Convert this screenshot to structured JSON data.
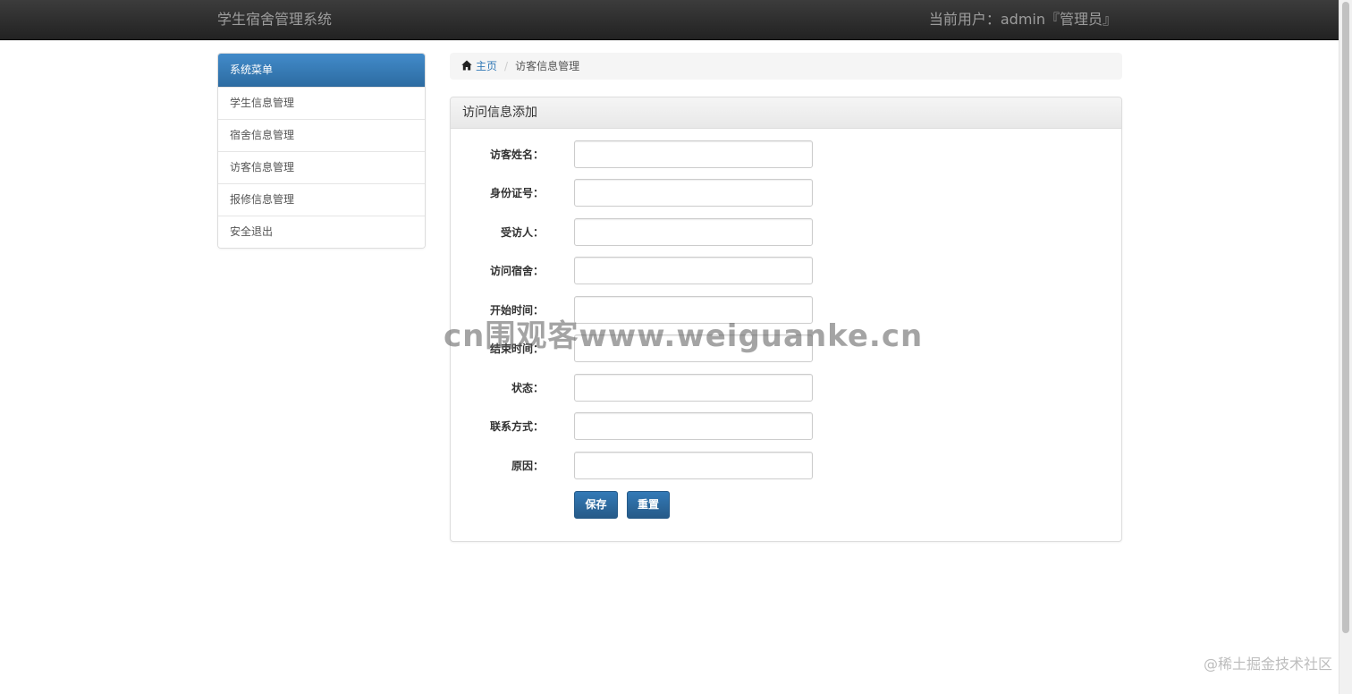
{
  "navbar": {
    "brand": "学生宿舍管理系统",
    "current_user": "当前用户：admin『管理员』"
  },
  "sidebar": {
    "heading": "系统菜单",
    "items": [
      {
        "label": "学生信息管理"
      },
      {
        "label": "宿舍信息管理"
      },
      {
        "label": "访客信息管理"
      },
      {
        "label": "报修信息管理"
      },
      {
        "label": "安全退出"
      }
    ]
  },
  "breadcrumb": {
    "home_icon": "home-icon",
    "home": "主页",
    "separator": "/",
    "current": "访客信息管理"
  },
  "panel": {
    "title": "访问信息添加"
  },
  "form": {
    "fields": [
      {
        "label": "访客姓名：",
        "value": ""
      },
      {
        "label": "身份证号：",
        "value": ""
      },
      {
        "label": "受访人：",
        "value": ""
      },
      {
        "label": "访问宿舍：",
        "value": ""
      },
      {
        "label": "开始时间：",
        "value": ""
      },
      {
        "label": "结束时间：",
        "value": ""
      },
      {
        "label": "状态：",
        "value": ""
      },
      {
        "label": "联系方式：",
        "value": ""
      },
      {
        "label": "原因：",
        "value": ""
      }
    ],
    "save_label": "保存",
    "reset_label": "重置"
  },
  "watermark": "cn围观客www.weiguanke.cn",
  "corner_watermark": "@稀土掘金技术社区",
  "colors": {
    "navbar_bg": "#222222",
    "primary": "#337ab7",
    "sidebar_heading": "#428bca"
  }
}
